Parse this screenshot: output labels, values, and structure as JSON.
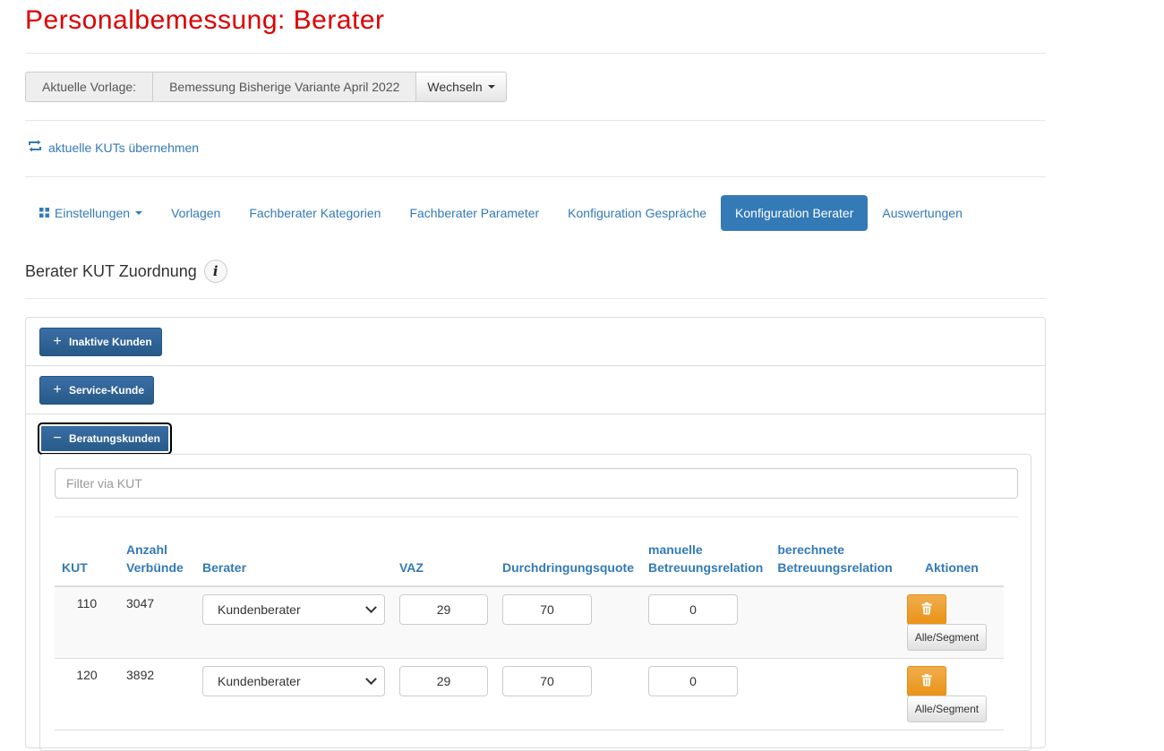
{
  "page": {
    "title": "Personalbemessung: Berater"
  },
  "template": {
    "label": "Aktuelle Vorlage:",
    "value": "Bemessung Bisherige Variante April 2022",
    "switch_label": "Wechseln"
  },
  "kut_link": {
    "label": "aktuelle KUTs übernehmen",
    "icon": "retweet-icon"
  },
  "nav": {
    "items": [
      {
        "label": "Einstellungen",
        "icon": "grid-icon",
        "dropdown": true
      },
      {
        "label": "Vorlagen"
      },
      {
        "label": "Fachberater Kategorien"
      },
      {
        "label": "Fachberater Parameter"
      },
      {
        "label": "Konfiguration Gespräche"
      },
      {
        "label": "Konfiguration Berater",
        "active": true
      },
      {
        "label": "Auswertungen"
      }
    ]
  },
  "section": {
    "title": "Berater KUT Zuordnung",
    "info_icon": "info-icon"
  },
  "panels": [
    {
      "label": "Inaktive Kunden",
      "sign": "+",
      "expanded": false
    },
    {
      "label": "Service-Kunde",
      "sign": "+",
      "expanded": false
    },
    {
      "label": "Beratungskunden",
      "sign": "−",
      "expanded": true
    }
  ],
  "filter": {
    "placeholder": "Filter via KUT",
    "value": ""
  },
  "table": {
    "headers": {
      "kut": "KUT",
      "anzahl_1": "Anzahl",
      "anzahl_2": "Verbünde",
      "berater": "Berater",
      "vaz": "VAZ",
      "quote": "Durchdringungsquote",
      "manuell_1": "manuelle",
      "manuell_2": "Betreuungsrelation",
      "berechnet_1": "berechnete",
      "berechnet_2": "Betreuungsrelation",
      "aktionen": "Aktionen"
    },
    "rows": [
      {
        "kut": "110",
        "anzahl": "3047",
        "berater": "Kundenberater",
        "vaz": "29",
        "quote": "70",
        "manuell": "0",
        "berechnet": "",
        "action_label": "Alle/Segment"
      },
      {
        "kut": "120",
        "anzahl": "3892",
        "berater": "Kundenberater",
        "vaz": "29",
        "quote": "70",
        "manuell": "0",
        "berechnet": "",
        "action_label": "Alle/Segment"
      }
    ]
  },
  "colors": {
    "title": "#dd0000",
    "link": "#337ab7",
    "primary": "#337ab7",
    "warning": "#f0ad4e"
  }
}
